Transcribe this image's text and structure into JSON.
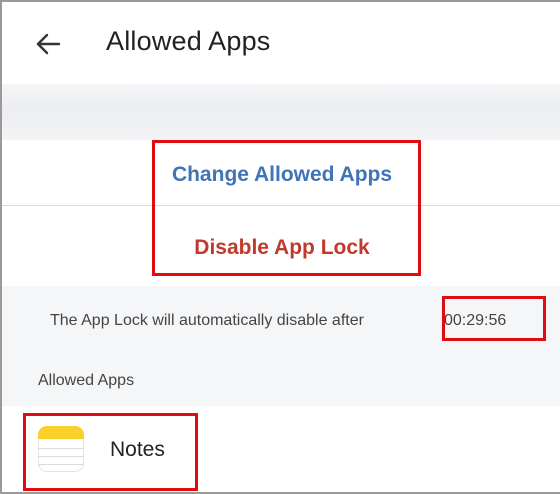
{
  "header": {
    "back_icon": "arrow-left-icon",
    "title": "Allowed Apps"
  },
  "actions": {
    "change_label": "Change Allowed Apps",
    "disable_label": "Disable App Lock"
  },
  "info": {
    "message": "The App Lock will automatically disable after",
    "countdown": "00:29:56"
  },
  "allowed_section": {
    "label": "Allowed Apps",
    "apps": [
      {
        "name": "Notes",
        "icon": "notes-app-icon"
      }
    ]
  },
  "colors": {
    "change_action": "#3f74b5",
    "disable_action": "#c0392b",
    "highlight": "#e00d10",
    "notes_icon_accent": "#f9cf2c"
  }
}
